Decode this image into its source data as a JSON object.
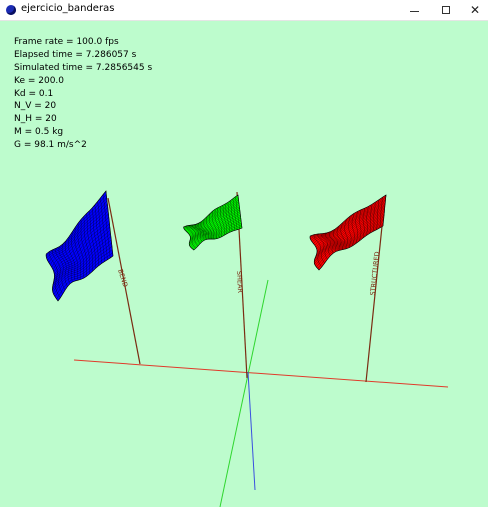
{
  "window": {
    "title": "ejercicio_banderas",
    "controls": {
      "minimize": "",
      "maximize": "",
      "close": "✕"
    }
  },
  "hud": {
    "frame_rate": "Frame rate = 100.0 fps",
    "elapsed_time": "Elapsed time = 7.286057 s",
    "simulated_time": "Simulated time = 7.2856545 s",
    "ke": "Ke = 200.0",
    "kd": "Kd = 0.1",
    "n_v": "N_V = 20",
    "n_h": "N_H = 20",
    "mass": "M = 0.5 kg",
    "gravity": "G = 98.1 m/s^2"
  },
  "flags": [
    {
      "label": "BEND",
      "color": "#0000ff"
    },
    {
      "label": "SHEAR",
      "color": "#00ff00"
    },
    {
      "label": "STRUCTURED",
      "color": "#ff0000"
    }
  ],
  "colors": {
    "background": "#bdfccd",
    "pole": "#7a2b12",
    "axis_x": "#e03a2a",
    "axis_y": "#2fd62f",
    "axis_z": "#3a4fe0"
  }
}
